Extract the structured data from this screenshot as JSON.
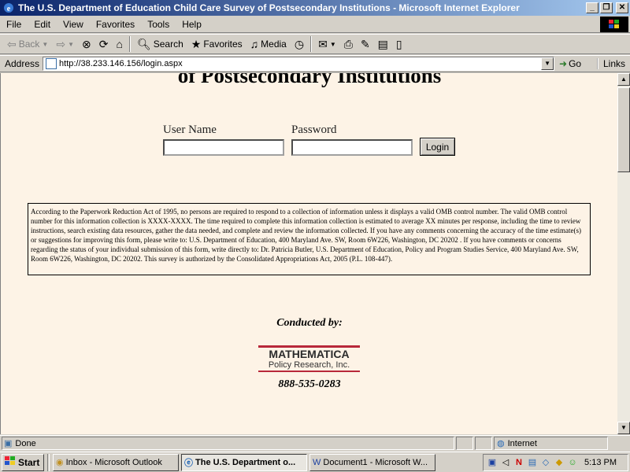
{
  "window": {
    "title": "The U.S. Department of Education Child Care Survey of Postsecondary Institutions - Microsoft Internet Explorer",
    "minimize": "_",
    "restore": "❐",
    "close": "✕"
  },
  "menu": {
    "items": [
      "File",
      "Edit",
      "View",
      "Favorites",
      "Tools",
      "Help"
    ]
  },
  "toolbar": {
    "back": "Back",
    "search": "Search",
    "favorites": "Favorites",
    "media": "Media"
  },
  "address": {
    "label": "Address",
    "url": "http://38.233.146.156/login.aspx",
    "go": "Go",
    "links": "Links"
  },
  "page": {
    "heading": "of Postsecondary Institutions",
    "login": {
      "username_label": "User Name",
      "password_label": "Password",
      "username_value": "",
      "password_value": "",
      "button": "Login"
    },
    "notice": "According to the Paperwork Reduction Act of 1995, no persons are required to respond to a collection of information unless it displays a valid OMB control number. The valid OMB control number for this information collection is XXXX-XXXX. The time required to complete this information collection is estimated to average XX minutes per response, including the time to review instructions, search existing data resources, gather the data needed, and complete and review the information collected. If you have any comments concerning the accuracy of the time estimate(s) or suggestions for improving this form, please write to: U.S. Department of Education, 400 Maryland Ave. SW, Room 6W226, Washington, DC 20202 . If you have comments or concerns regarding the status of your individual submission of this form, write directly to: Dr. Patricia Butler, U.S. Department of Education, Policy and Program Studies Service, 400 Maryland Ave. SW, Room 6W226, Washington, DC 20202. This survey is authorized by the Consolidated Appropriations Act, 2005 (P.L. 108-447).",
    "conducted_by": "Conducted by:",
    "logo": {
      "name": "MATHEMATICA",
      "sub": "Policy Research, Inc.",
      "accent": "#b8283a"
    },
    "phone": "888-535-0283"
  },
  "status": {
    "text": "Done",
    "zone": "Internet"
  },
  "taskbar": {
    "start": "Start",
    "tasks": [
      {
        "label": "Inbox - Microsoft Outlook",
        "active": false
      },
      {
        "label": "The U.S. Department o...",
        "active": true
      },
      {
        "label": "Document1 - Microsoft W...",
        "active": false
      }
    ],
    "clock": "5:13 PM"
  }
}
